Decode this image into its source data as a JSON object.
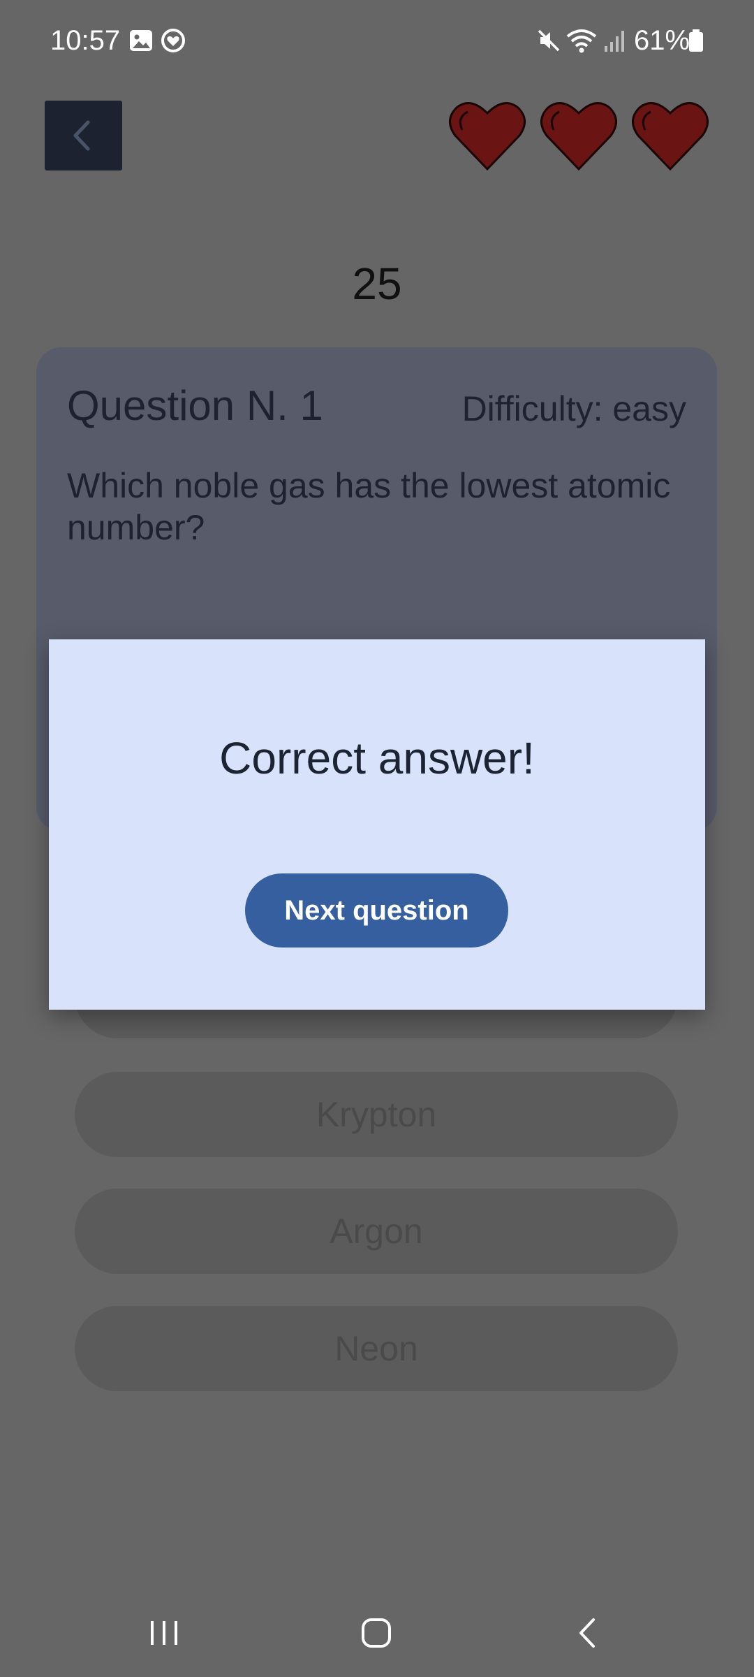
{
  "status_bar": {
    "time": "10:57",
    "battery": "61%",
    "icons": [
      "gallery-icon",
      "health-icon",
      "mute-icon",
      "wifi-icon",
      "signal-icon",
      "battery-icon"
    ]
  },
  "header": {
    "back_icon": "chevron-left-icon",
    "lives": 3,
    "life_icon": "heart-icon"
  },
  "timer": "25",
  "question": {
    "number_label": "Question N. 1",
    "difficulty_label": "Difficulty: easy",
    "text": "Which noble gas has the lowest atomic number?"
  },
  "answers": [
    "Krypton",
    "Argon",
    "Neon"
  ],
  "dialog": {
    "title": "Correct answer!",
    "button_label": "Next question"
  },
  "nav_bar": {
    "icons": [
      "recent-apps-icon",
      "home-icon",
      "back-icon"
    ]
  },
  "colors": {
    "overlay_background": "#666667",
    "dialog_background": "#d8e3fb",
    "button_primary": "#365f9f",
    "heart": "#6a1414",
    "back_button": "#1c2230"
  }
}
